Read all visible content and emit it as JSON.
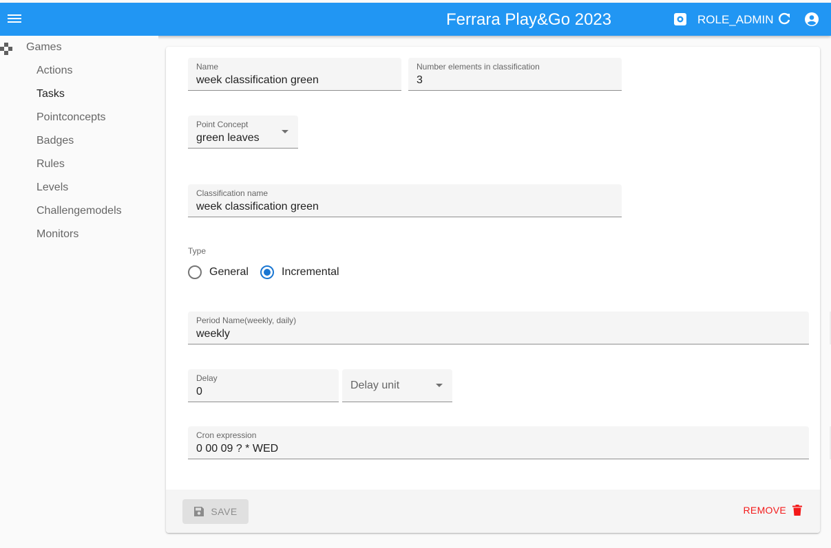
{
  "header": {
    "title": "Ferrara Play&Go 2023",
    "role": "ROLE_ADMIN",
    "icons": [
      "menu-icon",
      "settings-icon",
      "refresh-icon",
      "account-icon"
    ]
  },
  "sidebar": {
    "section_label": "Games",
    "items": [
      {
        "label": "Actions"
      },
      {
        "label": "Tasks"
      },
      {
        "label": "Pointconcepts"
      },
      {
        "label": "Badges"
      },
      {
        "label": "Rules"
      },
      {
        "label": "Levels"
      },
      {
        "label": "Challengemodels"
      },
      {
        "label": "Monitors"
      }
    ]
  },
  "form": {
    "name": {
      "label": "Name",
      "value": "week classification green"
    },
    "number_elements": {
      "label": "Number elements in classification",
      "value": "3"
    },
    "point_concept": {
      "label": "Point Concept",
      "value": "green leaves"
    },
    "classification_name": {
      "label": "Classification name",
      "value": "week classification green"
    },
    "type": {
      "label": "Type",
      "options": [
        {
          "label": "General",
          "checked": false
        },
        {
          "label": "Incremental",
          "checked": true
        }
      ]
    },
    "period_name": {
      "label": "Period Name(weekly, daily)",
      "value": "weekly"
    },
    "delay": {
      "label": "Delay",
      "value": "0"
    },
    "delay_unit": {
      "placeholder": "Delay unit"
    },
    "cron_expression": {
      "label": "Cron expression",
      "value": "0 00 09 ? * WED"
    }
  },
  "actions": {
    "save_label": "SAVE",
    "remove_label": "REMOVE"
  },
  "colors": {
    "primary": "#2196f3",
    "radio_selected": "#1976d2",
    "remove": "#f41a1a"
  }
}
